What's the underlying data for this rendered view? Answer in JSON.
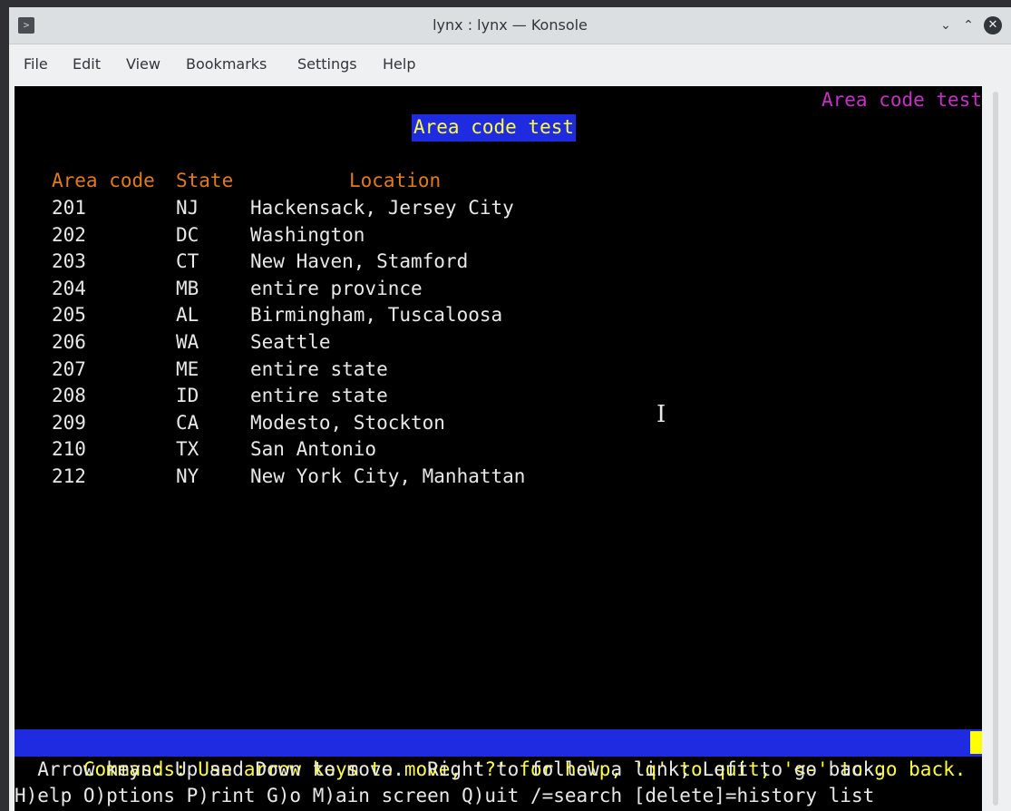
{
  "window": {
    "title": "lynx : lynx — Konsole",
    "app_icon": ">",
    "minimize_glyph": "⌄",
    "maximize_glyph": "⌃",
    "close_glyph": "✕"
  },
  "menu": {
    "items": [
      "File",
      "Edit",
      "View",
      "Bookmarks",
      "Settings",
      "Help"
    ]
  },
  "lynx": {
    "corner_title": "Area code test",
    "heading": "Area code test",
    "columns": [
      "Area code",
      "State",
      "Location"
    ],
    "rows": [
      {
        "code": "201",
        "state": "NJ",
        "location": "Hackensack, Jersey City"
      },
      {
        "code": "202",
        "state": "DC",
        "location": "Washington"
      },
      {
        "code": "203",
        "state": "CT",
        "location": "New Haven, Stamford"
      },
      {
        "code": "204",
        "state": "MB",
        "location": "entire province"
      },
      {
        "code": "205",
        "state": "AL",
        "location": "Birmingham, Tuscaloosa"
      },
      {
        "code": "206",
        "state": "WA",
        "location": "Seattle"
      },
      {
        "code": "207",
        "state": "ME",
        "location": "entire state"
      },
      {
        "code": "208",
        "state": "ID",
        "location": "entire state"
      },
      {
        "code": "209",
        "state": "CA",
        "location": "Modesto, Stockton"
      },
      {
        "code": "210",
        "state": "TX",
        "location": "San Antonio"
      },
      {
        "code": "212",
        "state": "NY",
        "location": "New York City, Manhattan"
      }
    ],
    "commands_line": "Commands: Use arrow keys to move, '?' for help, 'q' to quit, '<-' to go back.",
    "help_line_1": "  Arrow keys: Up and Down to move.  Right to follow a link; Left to go back.",
    "help_line_2": "H)elp O)ptions P)rint G)o M)ain screen Q)uit /=search [delete]=history list"
  },
  "colors": {
    "terminal_bg": "#000000",
    "heading_bg": "#1f2be0",
    "heading_fg": "#ffff40",
    "column_header": "#e07b1c",
    "corner_title": "#c530c5"
  }
}
